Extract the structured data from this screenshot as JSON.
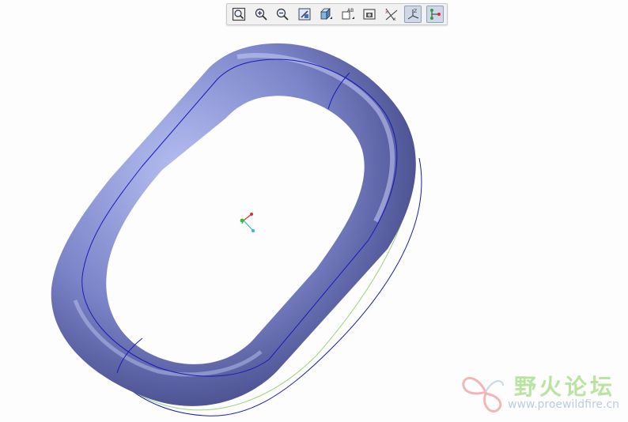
{
  "toolbar": {
    "buttons": [
      {
        "name": "refit-button",
        "icon": "refit-icon"
      },
      {
        "name": "zoom-in-button",
        "icon": "zoom-in-icon"
      },
      {
        "name": "zoom-out-button",
        "icon": "zoom-out-icon"
      },
      {
        "name": "repaint-button",
        "icon": "repaint-icon"
      },
      {
        "name": "display-style-button",
        "icon": "cube-icon"
      },
      {
        "name": "saved-views-button",
        "icon": "saved-view-icon"
      },
      {
        "name": "screenshot-button",
        "icon": "camera-icon"
      },
      {
        "name": "datum-planes-button",
        "icon": "datum-plane-icon"
      },
      {
        "name": "datum-csys-button",
        "icon": "csys-icon",
        "active": true
      },
      {
        "name": "datum-points-button",
        "icon": "datum-point-icon",
        "active": true
      }
    ]
  },
  "watermark": {
    "title": "野火论坛",
    "url": "www.proewildfire.cn"
  },
  "colors": {
    "model_fill": "#8088c8",
    "edge": "#1a1ab8",
    "csys_x": "#e03030",
    "csys_y": "#30c030",
    "csys_z": "#30c0c0"
  }
}
